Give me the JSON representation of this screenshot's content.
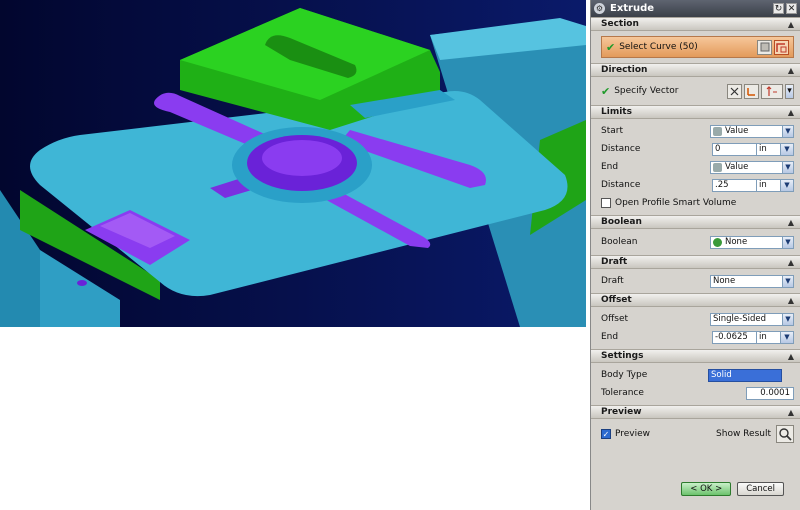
{
  "dialog": {
    "title": "Extrude",
    "sections": {
      "section": {
        "header": "Section",
        "select_curve_label": "Select Curve (50)"
      },
      "direction": {
        "header": "Direction",
        "specify_vector_label": "Specify Vector"
      },
      "limits": {
        "header": "Limits",
        "start_label": "Start",
        "start_value": "Value",
        "start_distance_label": "Distance",
        "start_distance_value": "0",
        "start_distance_unit": "in",
        "end_label": "End",
        "end_value": "Value",
        "end_distance_label": "Distance",
        "end_distance_value": ".25",
        "end_distance_unit": "in",
        "open_profile_label": "Open Profile Smart Volume"
      },
      "boolean": {
        "header": "Boolean",
        "label": "Boolean",
        "value": "None"
      },
      "draft": {
        "header": "Draft",
        "label": "Draft",
        "value": "None"
      },
      "offset": {
        "header": "Offset",
        "label": "Offset",
        "value": "Single-Sided",
        "end_label": "End",
        "end_value": "-0.0625",
        "end_unit": "in"
      },
      "settings": {
        "header": "Settings",
        "body_type_label": "Body Type",
        "body_type_value": "Solid",
        "tolerance_label": "Tolerance",
        "tolerance_value": "0.0001"
      },
      "preview": {
        "header": "Preview",
        "preview_label": "Preview",
        "preview_checked": true,
        "show_result_label": "Show Result"
      }
    },
    "buttons": {
      "ok": "< OK >",
      "cancel": "Cancel"
    }
  },
  "colors": {
    "viewport_background": "#050b4a",
    "part_blue": "#3fb6d6",
    "part_green": "#21c21a",
    "part_purple": "#8a3cf0",
    "selection_orange": "#e39a5b"
  }
}
